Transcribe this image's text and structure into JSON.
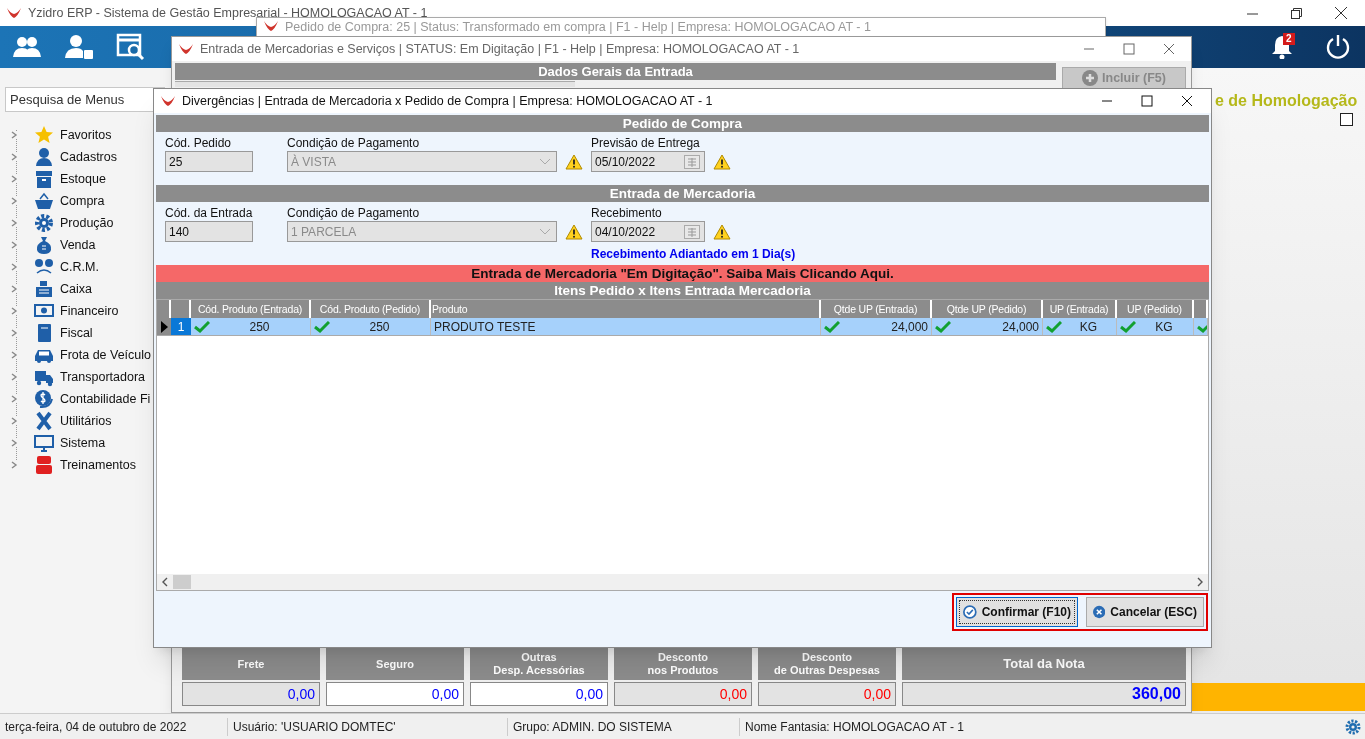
{
  "app_window": {
    "title": "Yzidro ERP - Sistema de Gestão Empresarial - HOMOLOGACAO AT - 1"
  },
  "toolbar": {
    "notification_count": "2"
  },
  "sidebar": {
    "search": {
      "placeholder": "Pesquisa de Menus"
    },
    "items": [
      {
        "label": "Favoritos",
        "expanded": false
      },
      {
        "label": "Cadastros",
        "expanded": false
      },
      {
        "label": "Estoque",
        "expanded": false
      },
      {
        "label": "Compra",
        "expanded": false
      },
      {
        "label": "Produção",
        "expanded": false
      },
      {
        "label": "Venda",
        "expanded": false
      },
      {
        "label": "C.R.M.",
        "expanded": false
      },
      {
        "label": "Caixa",
        "expanded": false
      },
      {
        "label": "Financeiro",
        "expanded": false
      },
      {
        "label": "Fiscal",
        "expanded": false
      },
      {
        "label": "Frota de Veículo",
        "expanded": false
      },
      {
        "label": "Transportadora",
        "expanded": false
      },
      {
        "label": "Contabilidade Fi",
        "expanded": false
      },
      {
        "label": "Utilitários",
        "expanded": false
      },
      {
        "label": "Sistema",
        "expanded": false
      },
      {
        "label": "Treinamentos",
        "expanded": false
      }
    ]
  },
  "environment_banner": "e de Homologação",
  "environment_checkbox": {
    "checked": false
  },
  "purchase_order_window": {
    "title": "Pedido de Compra: 25 | Status: Transformado em compra | F1 - Help | Empresa: HOMOLOGACAO AT - 1"
  },
  "entry_window": {
    "title": "Entrada de Mercadorias e Serviços | STATUS: Em Digitação | F1 - Help | Empresa: HOMOLOGACAO AT - 1",
    "section_title": "Dados Gerais da Entrada",
    "include_button": "Incluir (F5)",
    "totals": [
      {
        "label": "Frete",
        "value": "0,00",
        "editable": false,
        "color": "#0000ff",
        "kind": "normal"
      },
      {
        "label": "Seguro",
        "value": "0,00",
        "editable": true,
        "color": "#0000ff",
        "kind": "normal"
      },
      {
        "label": "Outras\nDesp. Acessórias",
        "value": "0,00",
        "editable": true,
        "color": "#0000ff",
        "kind": "normal"
      },
      {
        "label": "Desconto\nnos Produtos",
        "value": "0,00",
        "editable": false,
        "color": "#ff0000",
        "kind": "normal"
      },
      {
        "label": "Desconto\nde Outras Despesas",
        "value": "0,00",
        "editable": false,
        "color": "#ff0000",
        "kind": "normal"
      },
      {
        "label": "Total da Nota",
        "value": "360,00",
        "editable": false,
        "color": "#0000ff",
        "kind": "total"
      }
    ]
  },
  "dialog": {
    "title": "Divergências | Entrada de Mercadoria x Pedido de Compra | Empresa: HOMOLOGACAO AT - 1",
    "sections": [
      {
        "title": "Pedido de Compra",
        "fields": [
          {
            "label": "Cód. Pedido",
            "value": "25",
            "kind": "text",
            "warning": false
          },
          {
            "label": "Condição de Pagamento",
            "value": "À VISTA",
            "kind": "select",
            "warning": true
          },
          {
            "label": "Previsão de Entrega",
            "value": "05/10/2022",
            "kind": "date",
            "warning": true
          }
        ]
      },
      {
        "title": "Entrada de Mercadoria",
        "fields": [
          {
            "label": "Cód. da Entrada",
            "value": "140",
            "kind": "text",
            "warning": false
          },
          {
            "label": "Condição de Pagamento",
            "value": "1 PARCELA",
            "kind": "select",
            "warning": true
          },
          {
            "label": "Recebimento",
            "value": "04/10/2022",
            "kind": "date",
            "warning": true
          }
        ],
        "note": "Recebimento Adiantado em 1 Dia(s)"
      }
    ],
    "status_banner": "Entrada de Mercadoria \"Em Digitação\". Saiba Mais Clicando Aqui.",
    "grid_title": "Itens Pedido x Itens Entrada Mercadoria",
    "columns": [
      {
        "label": "Cód. Produto (Entrada)"
      },
      {
        "label": "Cód. Produto (Pedido)"
      },
      {
        "label": "Produto"
      },
      {
        "label": "Qtde UP (Entrada)"
      },
      {
        "label": "Qtde UP (Pedido)"
      },
      {
        "label": "UP (Entrada)"
      },
      {
        "label": "UP (Pedido)"
      },
      {}
    ],
    "rows": [
      {
        "number": "1",
        "selected": true,
        "cells": [
          {
            "value": "250",
            "ok": true
          },
          {
            "value": "250",
            "ok": true
          },
          {
            "value": "PRODUTO TESTE",
            "ok": false
          },
          {
            "value": "24,000",
            "ok": true
          },
          {
            "value": "24,000",
            "ok": true
          },
          {
            "value": "KG",
            "ok": true
          },
          {
            "value": "KG",
            "ok": true
          },
          {
            "ok": true
          }
        ]
      }
    ],
    "action_buttons": {
      "highlighted": true,
      "items": [
        {
          "label": "Confirmar (F10)",
          "focused": true,
          "kind": "confirm"
        },
        {
          "label": "Cancelar (ESC)",
          "focused": false,
          "kind": "cancel"
        }
      ]
    }
  },
  "status_bar": [
    "terça-feira, 04 de outubro de 2022",
    "Usuário: 'USUARIO DOMTEC'",
    "Grupo: ADMIN. DO SISTEMA",
    "Nome Fantasia: HOMOLOGACAO AT - 1"
  ]
}
